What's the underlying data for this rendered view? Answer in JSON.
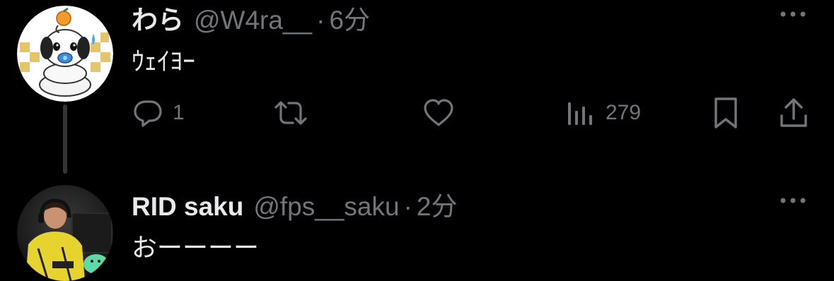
{
  "tweets": [
    {
      "display_name": "わら",
      "handle": "@W4ra__",
      "separator": "·",
      "time": "6分",
      "text": "ｳｪｲﾖｰ",
      "avatar_icon": "snake-mascot-avatar-icon",
      "actions": {
        "reply_count": "1",
        "retweet_count": "",
        "like_count": "",
        "views_count": "279"
      }
    },
    {
      "display_name": "RID saku",
      "handle": "@fps__saku",
      "separator": "·",
      "time": "2分",
      "text": "おーーーー",
      "avatar_icon": "gamer-photo-avatar-icon"
    }
  ],
  "icons": {
    "reply": "reply-icon",
    "retweet": "retweet-icon",
    "like": "heart-icon",
    "views": "views-icon",
    "bookmark": "bookmark-icon",
    "share": "share-icon",
    "more": "more-icon"
  },
  "colors": {
    "background": "#000000",
    "primary_text": "#e7e9ea",
    "secondary_text": "#71767b",
    "thread_line": "#333639"
  }
}
